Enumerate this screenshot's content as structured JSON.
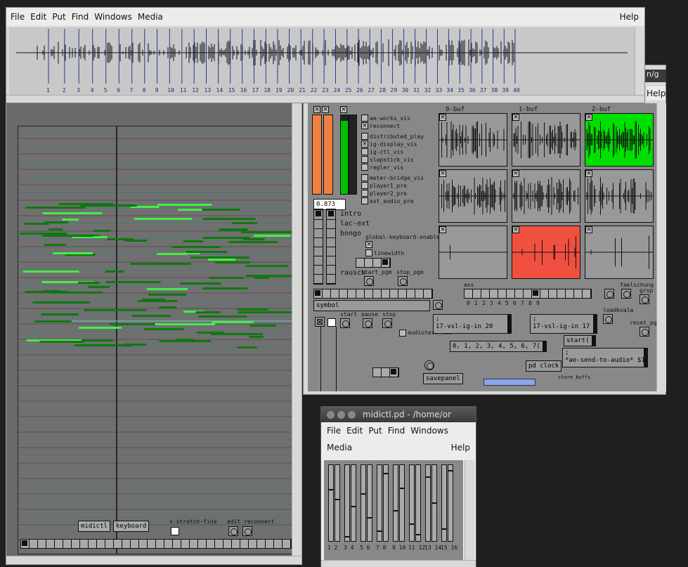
{
  "top_window": {
    "menu": [
      "File",
      "Edit",
      "Put",
      "Find",
      "Windows",
      "Media"
    ],
    "help": "Help",
    "markers": [
      "1",
      "2",
      "3",
      "4",
      "5",
      "6",
      "7",
      "8",
      "9",
      "10",
      "11",
      "12",
      "13",
      "14",
      "15",
      "16",
      "17",
      "18",
      "19",
      "20",
      "21",
      "22",
      "23",
      "24",
      "25",
      "26",
      "27",
      "28",
      "29",
      "30",
      "31",
      "32",
      "33",
      "34",
      "35",
      "36",
      "37",
      "38",
      "39",
      "40"
    ]
  },
  "right_panel": {
    "partial_title": "n/g",
    "partial_help": "Help",
    "toggles": [
      "ae-works_vis",
      "reconnect",
      "distributed_play",
      "ig-display_vis",
      "ig-ctl_vis",
      "slapstick_vis",
      "regler_vis",
      "meter-bridge_vis",
      "player1_pre",
      "player2_pre",
      "ext_audio_pre"
    ],
    "number_box": "0.873",
    "radio_labels": [
      "intro",
      "lac-ext",
      "bongo"
    ],
    "global_kb": "global-keyboard-enable",
    "linewidth": "linewidth",
    "rausch": "rausch",
    "start_pgm": "start_pgm",
    "stop_pgm": "stop_pgm",
    "buf_labels": [
      "0-buf",
      "1-buf",
      "2-buf"
    ],
    "axs": "axs",
    "faelschung": "faelschung",
    "grsp": "grsp",
    "loadkoala": "loadkoala",
    "reset_pgm": "reset_pgm",
    "digits": [
      "0",
      "1",
      "2",
      "3",
      "4",
      "5",
      "6",
      "7",
      "8",
      "9"
    ],
    "symbol": "symbol",
    "start": "start",
    "pause": "pause",
    "stop": "stop",
    "audiotest": "audiotest_vis",
    "msg1": "17-vsl-ig-in 20",
    "msg2": "17-vsl-ig-in 17",
    "msg_list": "0, 1, 2, 3, 4, 5, 6, 7(",
    "start_msg": "start(",
    "pd_clock": "pd clock",
    "send_audio": "*ae-send-to-audio* $1",
    "savepanel": "savepanel",
    "store_buffs": "store_buffs",
    "semicolon": ";"
  },
  "left_window": {
    "midictl_btn": "midictl",
    "keyboard_btn": "keyboard",
    "x_stretch": "x-stretch-fine",
    "edit_reconnect": "edit reconnect"
  },
  "midictl_window": {
    "title": "midictl.pd  - /home/or",
    "menu": [
      "File",
      "Edit",
      "Put",
      "Find",
      "Windows"
    ],
    "media": "Media",
    "help": "Help",
    "slider_labels": [
      "1 2",
      "3 4",
      "5 6",
      "7 8",
      "9 10",
      "11 12",
      "13 14",
      "15 16"
    ],
    "slider_values": [
      0.68,
      0.55,
      0.05,
      0.45,
      0.62,
      0.3,
      0.12,
      0.9,
      0.4,
      0.7,
      0.22,
      0.08,
      0.85,
      0.5,
      0.15,
      0.93
    ]
  },
  "colors": {
    "pd_gray": "#999999",
    "orange": "#f08040",
    "green": "#00e000",
    "red": "#f05040",
    "piano_bg": "#6f6f6f"
  }
}
